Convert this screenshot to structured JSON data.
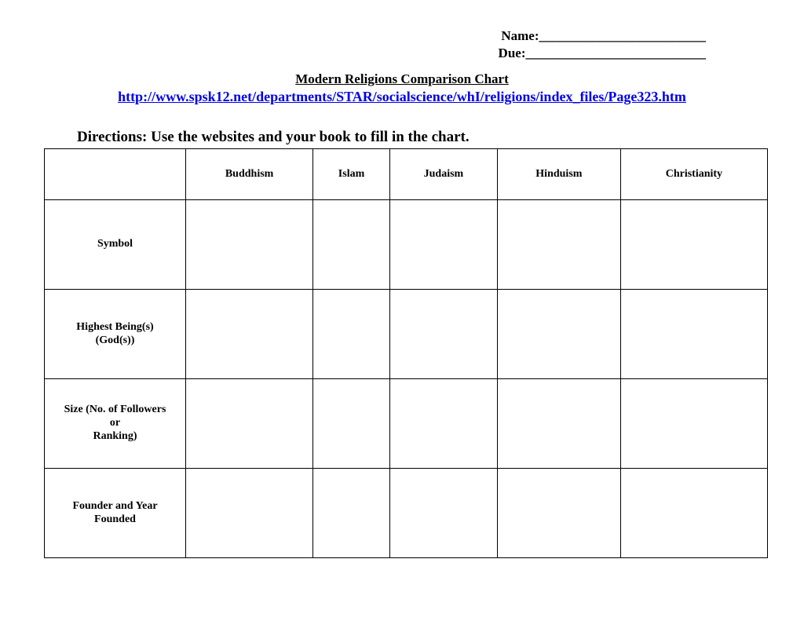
{
  "header": {
    "nameLabel": "Name:_________________________",
    "dueLabel": "Due:___________________________"
  },
  "title": "Modern Religions Comparison Chart",
  "url": "http://www.spsk12.net/departments/STAR/socialscience/whI/religions/index_files/Page323.htm",
  "directions": "Directions:  Use the websites and your book to fill in the chart.",
  "chart_data": {
    "type": "table",
    "columns": [
      "",
      "Buddhism",
      "Islam",
      "Judaism",
      "Hinduism",
      "Christianity"
    ],
    "rows": [
      {
        "label": "Symbol",
        "cells": [
          "",
          "",
          "",
          "",
          ""
        ]
      },
      {
        "label": "Highest Being(s) (God(s))",
        "cells": [
          "",
          "",
          "",
          "",
          ""
        ]
      },
      {
        "label": "Size (No. of Followers or Ranking)",
        "labelHtml": "Size (No. of Followers<br>or<br>Ranking)",
        "cells": [
          "",
          "",
          "",
          "",
          ""
        ]
      },
      {
        "label": "Founder and Year Founded",
        "cells": [
          "",
          "",
          "",
          "",
          ""
        ]
      }
    ]
  }
}
